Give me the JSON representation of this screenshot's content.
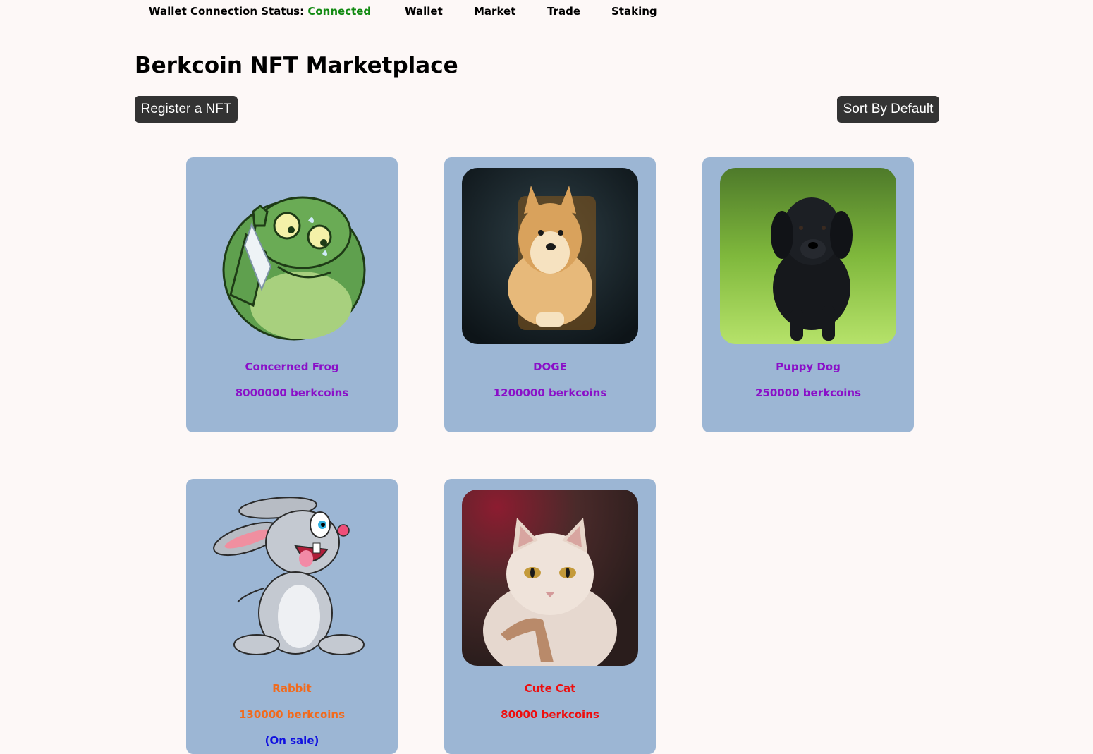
{
  "topbar": {
    "status_label": "Wallet Connection Status:",
    "status_value": "Connected",
    "nav": [
      "Wallet",
      "Market",
      "Trade",
      "Staking"
    ]
  },
  "page": {
    "title": "Berkcoin NFT Marketplace",
    "register_button": "Register a NFT",
    "sort_button": "Sort By Default"
  },
  "colors": {
    "connected": "#118a11",
    "card_bg": "#9cb6d4",
    "purple_text": "#8a10c8",
    "orange_text": "#f26a1b",
    "red_text": "#ee0e0e",
    "sale_text": "#1010e0"
  },
  "nfts": [
    {
      "name": "Concerned Frog",
      "price": "8000000 berkcoins",
      "sale": "",
      "image": "concerned-frog"
    },
    {
      "name": "DOGE",
      "price": "1200000 berkcoins",
      "sale": "",
      "image": "doge"
    },
    {
      "name": "Puppy Dog",
      "price": "250000 berkcoins",
      "sale": "",
      "image": "puppy-dog"
    },
    {
      "name": "Rabbit",
      "price": "130000 berkcoins",
      "sale": "(On sale)",
      "image": "rabbit"
    },
    {
      "name": "Cute Cat",
      "price": "80000 berkcoins",
      "sale": "",
      "image": "cute-cat"
    }
  ]
}
